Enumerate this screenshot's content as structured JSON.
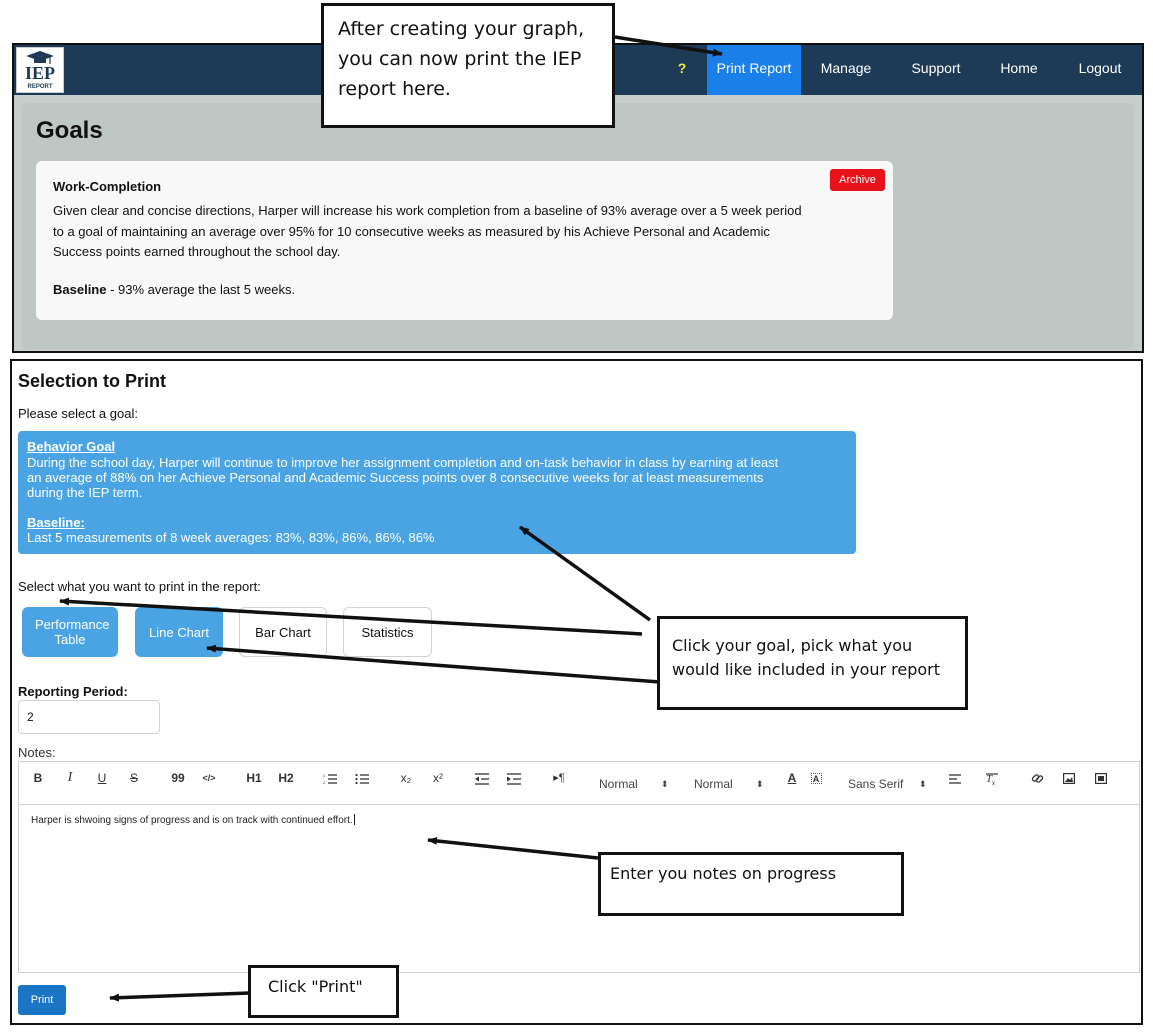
{
  "navbar": {
    "logo_text": "IEP",
    "logo_subtext": "REPORT",
    "help_label": "?",
    "items": [
      "Print Report",
      "Manage",
      "Support",
      "Home",
      "Logout"
    ],
    "active_item": "Print Report",
    "colors": {
      "background": "#1d3a56",
      "active": "#1b7fea",
      "help": "#f1e84c"
    }
  },
  "goals_page": {
    "title": "Goals",
    "goal": {
      "name": "Work-Completion",
      "description": "Given clear and concise directions, Harper will increase his work completion from a baseline of 93% average over a 5 week period to a goal of maintaining an average over 95% for 10 consecutive weeks as measured by his Achieve Personal and Academic Success points earned throughout the school day.",
      "baseline_label": "Baseline",
      "baseline_text": " - 93% average the last 5 weeks.",
      "archive_label": "Archive"
    }
  },
  "selection": {
    "title": "Selection to Print",
    "prompt": "Please select a goal:",
    "goal_card": {
      "title": "Behavior Goal",
      "description": "During the school day, Harper will continue to improve her assignment completion and on-task behavior in class by earning at least an average of 88% on her Achieve Personal and Academic Success points over 8 consecutive weeks for at least measurements during the IEP term.",
      "baseline_label": "Baseline:",
      "baseline_text": "Last 5 measurements of 8 week averages: 83%, 83%, 86%, 86%, 86%"
    },
    "print_prompt": "Select what you want to print in the report:",
    "options": [
      {
        "label": "Performance Table",
        "selected": true
      },
      {
        "label": "Line Chart",
        "selected": true
      },
      {
        "label": "Bar Chart",
        "selected": false
      },
      {
        "label": "Statistics",
        "selected": false
      }
    ],
    "reporting_period_label": "Reporting Period:",
    "reporting_period_value": "2",
    "notes_label": "Notes:",
    "toolbar": {
      "bold": "B",
      "italic": "I",
      "underline": "U",
      "strike": "S",
      "blockquote": "99",
      "code": "</>",
      "h1": "H1",
      "h2": "H2",
      "subscript": "x₂",
      "superscript": "x²",
      "direction": "▸¶",
      "size_select": "Normal",
      "header_select": "Normal",
      "font_select": "Sans Serif",
      "color": "A"
    },
    "notes_text": "Harper is shwoing signs of progress and is on track with continued effort.",
    "print_button": "Print",
    "accent_color": "#4aa4e4"
  },
  "callouts": {
    "print_report": "After creating your graph, you can now print the IEP report here.",
    "pick_goal": "Click your goal, pick what you would like included in your report",
    "notes": "Enter you notes on progress",
    "print": "Click \"Print\""
  }
}
